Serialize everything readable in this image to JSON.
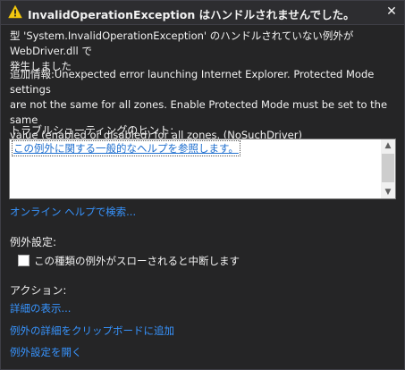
{
  "title": "InvalidOperationException はハンドルされませんでした。",
  "message": {
    "line1": "型 'System.InvalidOperationException' のハンドルされていない例外が WebDriver.dll で",
    "line2": "発生しました",
    "detail1": "追加情報:Unexpected error launching Internet Explorer. Protected Mode settings",
    "detail2": "are not the same for all zones. Enable Protected Mode must be set to the same",
    "detail3": "value (enabled or disabled) for all zones. (NoSuchDriver)"
  },
  "troubleshooting": {
    "heading": "トラブルシューティングのヒント:",
    "hint": "この例外に関する一般的なヘルプを参照します。",
    "search_link": "オンライン ヘルプで検索..."
  },
  "exception_settings": {
    "heading": "例外設定:",
    "checkbox_label": "この種類の例外がスローされると中断します",
    "checked": false
  },
  "actions": {
    "heading": "アクション:",
    "view_details": "詳細の表示...",
    "copy_details": "例外の詳細をクリップボードに追加",
    "open_settings": "例外設定を開く"
  },
  "icons": {
    "title": "warning-icon",
    "close": "close-icon"
  },
  "colors": {
    "link": "#3794ff",
    "background": "#252526",
    "warning": "#f2c811"
  }
}
